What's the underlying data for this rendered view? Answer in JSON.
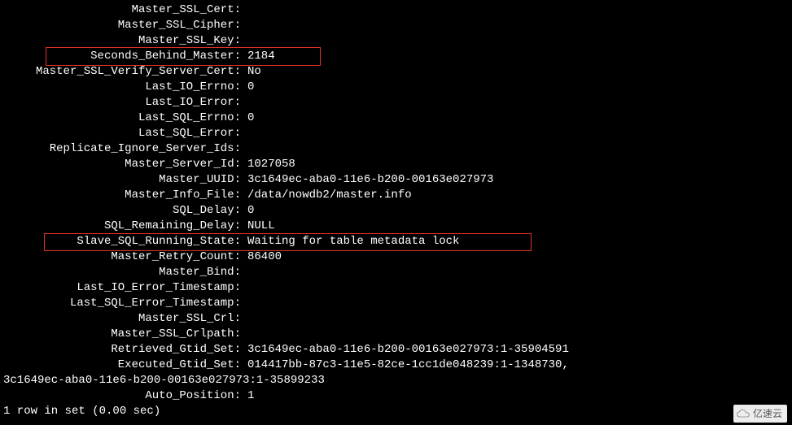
{
  "rows": [
    {
      "label": "Master_SSL_Cert:",
      "value": ""
    },
    {
      "label": "Master_SSL_Cipher:",
      "value": ""
    },
    {
      "label": "Master_SSL_Key:",
      "value": ""
    },
    {
      "label": "Seconds_Behind_Master:",
      "value": "2184"
    },
    {
      "label": "Master_SSL_Verify_Server_Cert:",
      "value": "No"
    },
    {
      "label": "Last_IO_Errno:",
      "value": "0"
    },
    {
      "label": "Last_IO_Error:",
      "value": ""
    },
    {
      "label": "Last_SQL_Errno:",
      "value": "0"
    },
    {
      "label": "Last_SQL_Error:",
      "value": ""
    },
    {
      "label": "Replicate_Ignore_Server_Ids:",
      "value": ""
    },
    {
      "label": "Master_Server_Id:",
      "value": "1027058"
    },
    {
      "label": "Master_UUID:",
      "value": "3c1649ec-aba0-11e6-b200-00163e027973"
    },
    {
      "label": "Master_Info_File:",
      "value": "/data/nowdb2/master.info"
    },
    {
      "label": "SQL_Delay:",
      "value": "0"
    },
    {
      "label": "SQL_Remaining_Delay:",
      "value": "NULL"
    },
    {
      "label": "Slave_SQL_Running_State:",
      "value": "Waiting for table metadata lock"
    },
    {
      "label": "Master_Retry_Count:",
      "value": "86400"
    },
    {
      "label": "Master_Bind:",
      "value": ""
    },
    {
      "label": "Last_IO_Error_Timestamp:",
      "value": ""
    },
    {
      "label": "Last_SQL_Error_Timestamp:",
      "value": ""
    },
    {
      "label": "Master_SSL_Crl:",
      "value": ""
    },
    {
      "label": "Master_SSL_Crlpath:",
      "value": ""
    },
    {
      "label": "Retrieved_Gtid_Set:",
      "value": "3c1649ec-aba0-11e6-b200-00163e027973:1-35904591"
    },
    {
      "label": "Executed_Gtid_Set:",
      "value": "014417bb-87c3-11e5-82ce-1cc1de048239:1-1348730,"
    }
  ],
  "continuation": "3c1649ec-aba0-11e6-b200-00163e027973:1-35899233",
  "rows2": [
    {
      "label": "Auto_Position:",
      "value": "1"
    }
  ],
  "footer": "1 row in set (0.00 sec)",
  "watermark": "亿速云"
}
